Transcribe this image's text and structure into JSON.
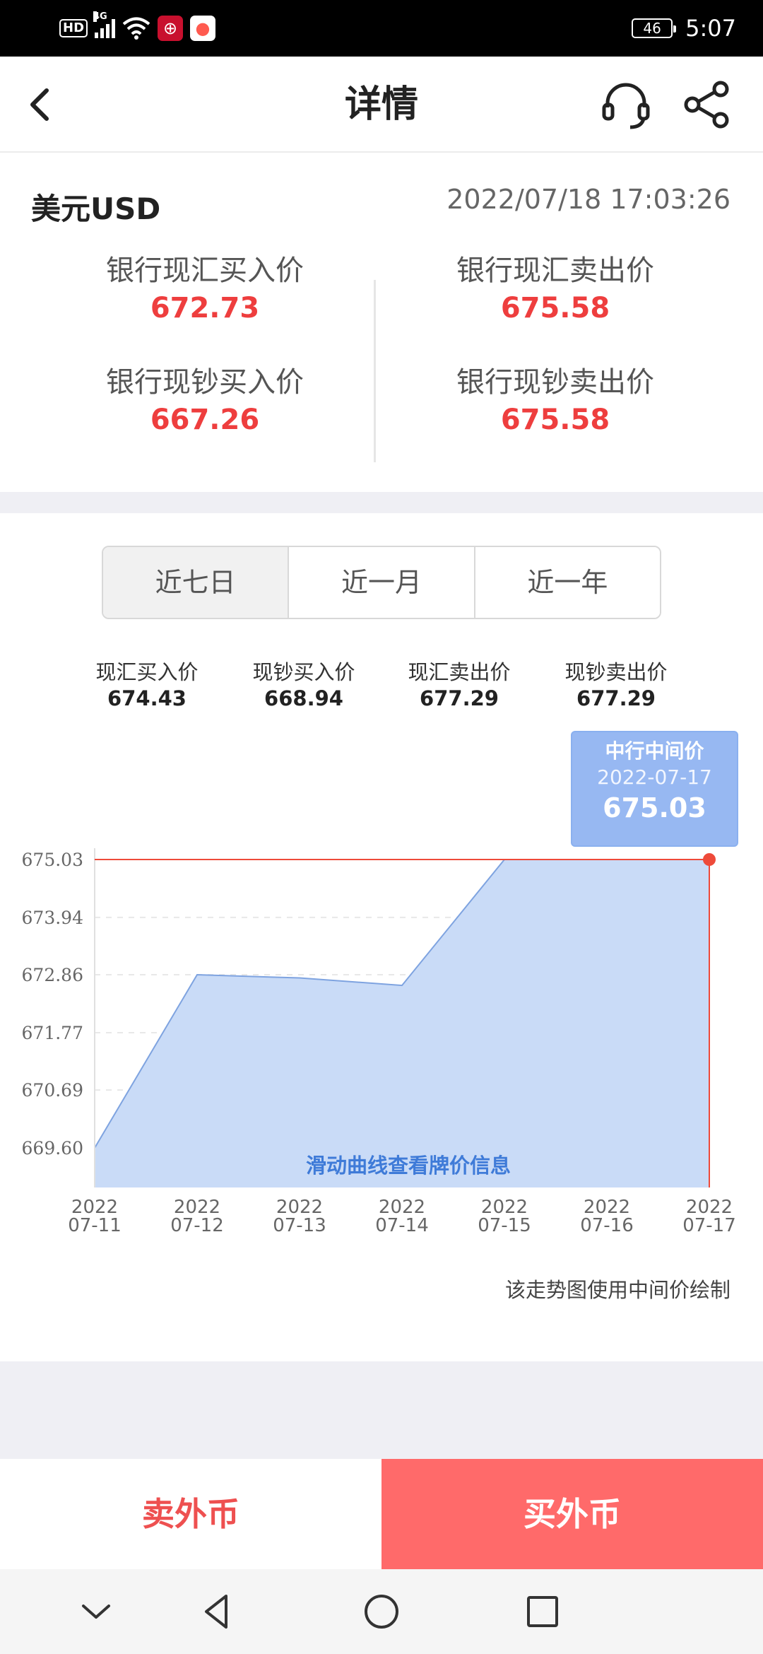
{
  "status_bar": {
    "hd": "HD",
    "network": "4G",
    "battery": "46",
    "time": "5:07",
    "icons": [
      "hd-icon",
      "signal-icon",
      "wifi-icon",
      "bank-app-icon",
      "chat-app-icon",
      "battery-icon"
    ]
  },
  "header": {
    "title": "详情",
    "icons": [
      "back-arrow-icon",
      "headset-icon",
      "share-icon"
    ]
  },
  "quote": {
    "currency": "美元USD",
    "timestamp": "2022/07/18 17:03:26",
    "items": [
      {
        "label": "银行现汇买入价",
        "value": "672.73"
      },
      {
        "label": "银行现汇卖出价",
        "value": "675.58"
      },
      {
        "label": "银行现钞买入价",
        "value": "667.26"
      },
      {
        "label": "银行现钞卖出价",
        "value": "675.58"
      }
    ],
    "value_color": "#ee3e3e"
  },
  "tabs": [
    {
      "label": "近七日",
      "active": true
    },
    {
      "label": "近一月",
      "active": false
    },
    {
      "label": "近一年",
      "active": false
    }
  ],
  "stats": [
    {
      "label": "现汇买入价",
      "value": "674.43"
    },
    {
      "label": "现钞买入价",
      "value": "668.94"
    },
    {
      "label": "现汇卖出价",
      "value": "677.29"
    },
    {
      "label": "现钞卖出价",
      "value": "677.29"
    }
  ],
  "tooltip": {
    "title": "中行中间价",
    "date": "2022-07-17",
    "value": "675.03"
  },
  "chart_data": {
    "type": "area",
    "x": [
      "2022-07-11",
      "2022-07-12",
      "2022-07-13",
      "2022-07-14",
      "2022-07-15",
      "2022-07-16",
      "2022-07-17"
    ],
    "x_tick_labels": [
      [
        "2022",
        "07-11"
      ],
      [
        "2022",
        "07-12"
      ],
      [
        "2022",
        "07-13"
      ],
      [
        "2022",
        "07-14"
      ],
      [
        "2022",
        "07-15"
      ],
      [
        "2022",
        "07-16"
      ],
      [
        "2022",
        "07-17"
      ]
    ],
    "series": [
      {
        "values": [
          669.6,
          672.86,
          672.8,
          672.66,
          675.03,
          675.03,
          675.03
        ],
        "color": "#c9dbf7"
      }
    ],
    "y_ticks": [
      "675.03",
      "673.94",
      "672.86",
      "671.77",
      "670.69",
      "669.60"
    ],
    "ylim": [
      668.8,
      675.03
    ],
    "highlight_index": 6,
    "highlight_color": "#ee4a3a",
    "grid": true
  },
  "chart_hint": "滑动曲线查看牌价信息",
  "chart_note": "该走势图使用中间价绘制",
  "actions": {
    "sell": "卖外币",
    "buy": "买外币"
  },
  "navbar": {
    "icons": [
      "collapse-chevron-icon",
      "nav-back-icon",
      "nav-home-icon",
      "nav-recents-icon"
    ]
  }
}
